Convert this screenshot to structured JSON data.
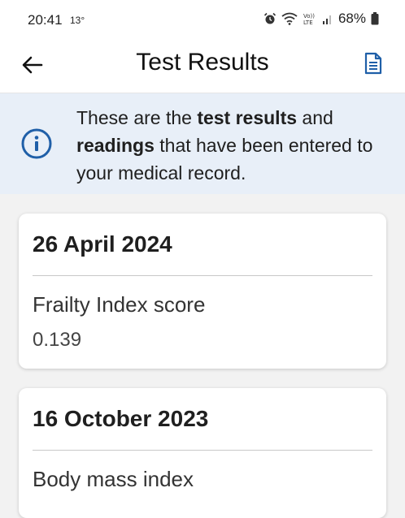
{
  "status_bar": {
    "time": "20:41",
    "temperature": "13°",
    "battery": "68%",
    "icons": [
      "alarm-icon",
      "wifi-icon",
      "volte-icon",
      "signal-icon",
      "battery-icon"
    ]
  },
  "header": {
    "title": "Test Results",
    "back_icon": "arrow-left-icon",
    "action_icon": "document-icon"
  },
  "info_banner": {
    "icon": "info-circle-icon",
    "text_before": "These are the ",
    "bold_1": "test results",
    "text_middle": " and ",
    "bold_2": "readings",
    "text_after": " that have been entered to your medical record."
  },
  "results": [
    {
      "date": "26 April 2024",
      "label": "Frailty Index score",
      "value": "0.139"
    },
    {
      "date": "16 October 2023",
      "label": "Body mass index",
      "value": ""
    }
  ],
  "colors": {
    "banner_bg": "#e8eff8",
    "accent_blue": "#1f5fa8",
    "page_bg": "#f2f2f2"
  }
}
